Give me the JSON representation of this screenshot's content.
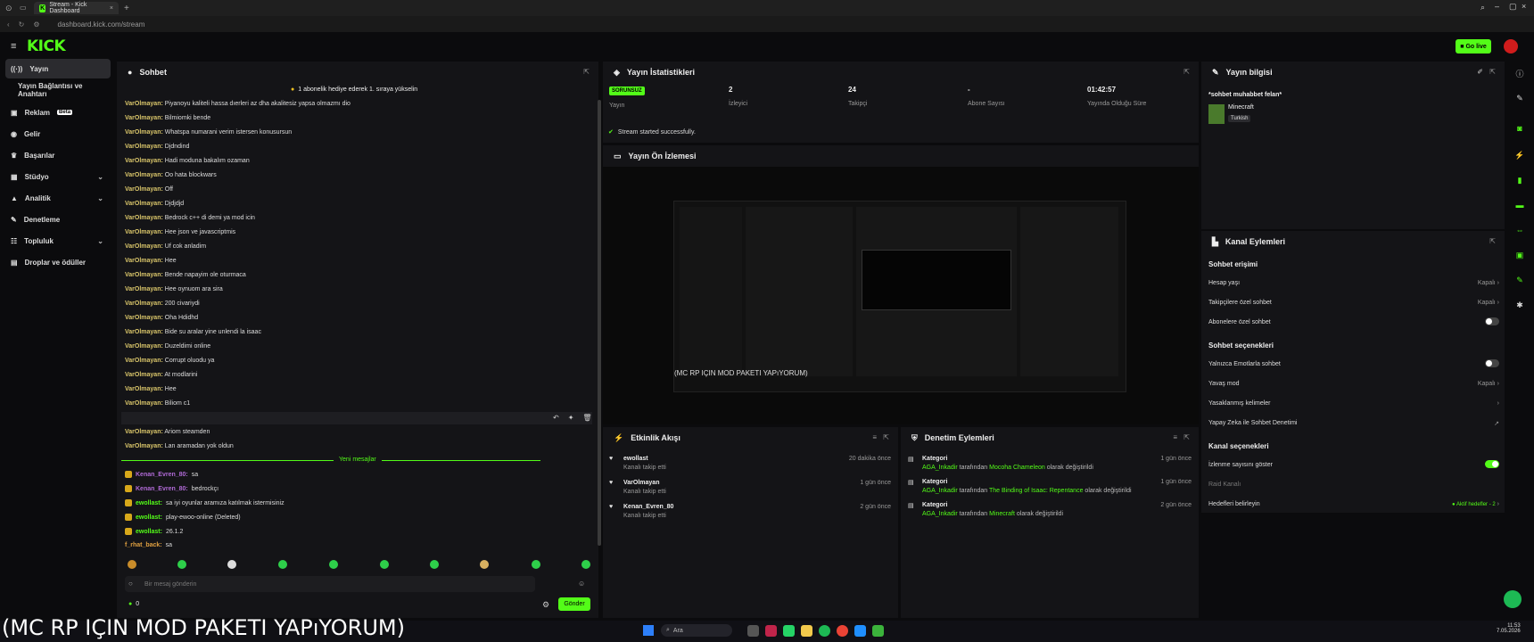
{
  "browser": {
    "tab_title": "Stream - Kick Dashboard",
    "url": "dashboard.kick.com/stream"
  },
  "app": {
    "logo": "KICK",
    "go_live": "Go live"
  },
  "sidebar": {
    "items": [
      {
        "label": "Yayın"
      },
      {
        "label": "Yayın Bağlantısı ve Anahtarı"
      },
      {
        "label": "Reklam",
        "badge": "Beta"
      },
      {
        "label": "Gelir"
      },
      {
        "label": "Başarılar"
      },
      {
        "label": "Stüdyo"
      },
      {
        "label": "Analitik"
      },
      {
        "label": "Denetleme"
      },
      {
        "label": "Topluluk"
      },
      {
        "label": "Droplar ve ödüller"
      }
    ]
  },
  "chat": {
    "title": "Sohbet",
    "pinned": "1 abonelik hediye ederek 1. sıraya yükselin",
    "messages": [
      {
        "user": "VarOlmayan:",
        "text": "Piyanoyu kaliteli hassa dıerleri az dha akalitesiz yapsa olmazmı dio"
      },
      {
        "user": "VarOlmayan:",
        "text": "Bilmiomki bende"
      },
      {
        "user": "VarOlmayan:",
        "text": "Whatspa numarani verim istersen konusursun"
      },
      {
        "user": "VarOlmayan:",
        "text": "Djdndind"
      },
      {
        "user": "VarOlmayan:",
        "text": "Hadi moduna bakalım ozaman"
      },
      {
        "user": "VarOlmayan:",
        "text": "Oo hata blockwars"
      },
      {
        "user": "VarOlmayan:",
        "text": "Off"
      },
      {
        "user": "VarOlmayan:",
        "text": "Djdjdjd"
      },
      {
        "user": "VarOlmayan:",
        "text": "Bedrock c++ di demi ya mod icin"
      },
      {
        "user": "VarOlmayan:",
        "text": "Hee json ve javascriptmis"
      },
      {
        "user": "VarOlmayan:",
        "text": "Uf cok anladim"
      },
      {
        "user": "VarOlmayan:",
        "text": "Hee"
      },
      {
        "user": "VarOlmayan:",
        "text": "Bende napayim ole oturmaca"
      },
      {
        "user": "VarOlmayan:",
        "text": "Hee oynuom ara sira"
      },
      {
        "user": "VarOlmayan:",
        "text": "200 civariydi"
      },
      {
        "user": "VarOlmayan:",
        "text": "Oha Hdidhd"
      },
      {
        "user": "VarOlmayan:",
        "text": "Bide su aralar yine unlendi la isaac"
      },
      {
        "user": "VarOlmayan:",
        "text": "Duzeldimi online"
      },
      {
        "user": "VarOlmayan:",
        "text": "Corrupt oluodu ya"
      },
      {
        "user": "VarOlmayan:",
        "text": "At modlarini"
      },
      {
        "user": "VarOlmayan:",
        "text": "Hee"
      },
      {
        "user": "VarOlmayan:",
        "text": "Biliom c1"
      },
      {
        "user": "VarOlmayan:",
        "text": "Steam acilio"
      },
      {
        "user": "VarOlmayan:",
        "text": "Ariom steamden"
      },
      {
        "user": "VarOlmayan:",
        "text": "Lan aramadan yok oldun"
      }
    ],
    "new_messages": "Yeni mesajlar",
    "new": [
      {
        "user": "Kenan_Evren_80:",
        "text": "sa",
        "color": "#b06ad6"
      },
      {
        "user": "Kenan_Evren_80:",
        "text": "bedrockçı",
        "color": "#b06ad6"
      },
      {
        "user": "ewollast:",
        "text": "sa iyi oyunlar aramıza katılmak istermisiniz",
        "color": "#53fc18"
      },
      {
        "user": "ewollast:",
        "text": "play-ewoo-online (Deleted)",
        "color": "#53fc18"
      },
      {
        "user": "ewollast:",
        "text": "26.1.2",
        "color": "#53fc18"
      },
      {
        "user": "f_rhat_back:",
        "text": "sa",
        "color": "#e0a040"
      }
    ],
    "input_placeholder": "Bir mesaj gönderin",
    "count": "0",
    "send": "Gönder"
  },
  "stats": {
    "title": "Yayın İstatistikleri",
    "items": [
      {
        "value": "SORUNSUZ",
        "label": "Yayın"
      },
      {
        "value": "2",
        "label": "İzleyici"
      },
      {
        "value": "24",
        "label": "Takipçi"
      },
      {
        "value": "-",
        "label": "Abone Sayısı"
      },
      {
        "value": "01:42:57",
        "label": "Yayında Olduğu Süre"
      }
    ],
    "status": "Stream started successfully."
  },
  "preview": {
    "title": "Yayın Ön İzlemesi",
    "caption": "(MC RP IÇIN MOD PAKETI YAPıYORUM)"
  },
  "activity": {
    "title": "Etkinlik Akışı",
    "items": [
      {
        "user": "ewollast",
        "action": "Kanalı takip etti",
        "time": "20 dakika önce"
      },
      {
        "user": "VarOlmayan",
        "action": "Kanalı takip etti",
        "time": "1 gün önce"
      },
      {
        "user": "Kenan_Evren_80",
        "action": "Kanalı takip etti",
        "time": "2 gün önce"
      }
    ]
  },
  "moderation": {
    "title": "Denetim Eylemleri",
    "items": [
      {
        "title": "Kategori",
        "user": "AGA_Inkadir",
        "mid": "tarafından",
        "target": "Mocoha Chameleon",
        "end": "olarak değiştirildi",
        "time": "1 gün önce"
      },
      {
        "title": "Kategori",
        "user": "AGA_Inkadir",
        "mid": "tarafından",
        "target": "The Binding of Isaac: Repentance",
        "end": "olarak değiştirildi",
        "time": "1 gün önce"
      },
      {
        "title": "Kategori",
        "user": "AGA_Inkadir",
        "mid": "tarafından",
        "target": "Minecraft",
        "end": "olarak değiştirildi",
        "time": "2 gün önce"
      }
    ]
  },
  "info": {
    "title": "Yayın bilgisi",
    "stream_title": "*sohbet muhabbet felan*",
    "category": "Minecraft",
    "language": "Turkish"
  },
  "channel": {
    "title": "Kanal Eylemleri",
    "sections": {
      "access": "Sohbet erişimi",
      "options": "Sohbet seçenekleri",
      "channel": "Kanal seçenekleri"
    },
    "rows": {
      "account_age": "Hesap yaşı",
      "account_age_val": "Kapalı",
      "followers_only": "Takipçilere özel sohbet",
      "followers_only_val": "Kapalı",
      "subs_only": "Abonelere özel sohbet",
      "emotes_only": "Yalnızca Emotlarla sohbet",
      "slow": "Yavaş mod",
      "slow_val": "Kapalı",
      "banned_words": "Yasaklanmış kelimeler",
      "ai_mod": "Yapay Zeka ile Sohbet Denetimi",
      "show_viewers": "İzlenme sayısını göster",
      "raid": "Raid Kanalı",
      "goals": "Hedefleri belirleyin",
      "goals_val": "● Aktif hedefler - 2"
    }
  },
  "taskbar": {
    "search": "Ara",
    "time": "11:53",
    "date": "7.05.2026"
  },
  "overlay": {
    "caption": "(MC RP IÇIN MOD PAKETI YAPıYORUM)"
  },
  "colors": {
    "accent": "#53fc18",
    "panel": "#141417",
    "background": "#0b0b0d"
  }
}
